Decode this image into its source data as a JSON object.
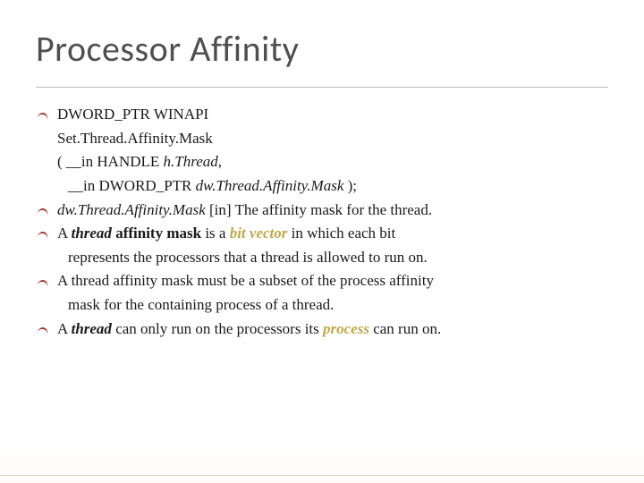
{
  "title": "Processor Affinity",
  "b1_l1": "DWORD_PTR WINAPI",
  "b1_l2": "Set.Thread.Affinity.Mask",
  "b1_l3_a": "( __in HANDLE ",
  "b1_l3_b": "h.Thread",
  "b1_l3_c": ",",
  "b1_l4_a": "__in DWORD_PTR ",
  "b1_l4_b": "dw.Thread.Affinity.Mask",
  "b1_l4_c": " );",
  "b2_a": "dw.Thread.Affinity.Mask",
  "b2_b": " [in] The affinity mask for the thread.",
  "b3_a": "A ",
  "b3_b": "thread",
  "b3_c": " ",
  "b3_d": "affinity mask",
  "b3_e": " is a ",
  "b3_f": "bit vector",
  "b3_g": " in which each bit",
  "b3_cont": "represents the processors that a thread is allowed to run on.",
  "b4": "A thread affinity mask must be a subset of the process affinity",
  "b4_cont": "mask for the containing process of a thread.",
  "b5_a": "A ",
  "b5_b": "thread",
  "b5_c": " can only run on the processors its ",
  "b5_d": "process",
  "b5_e": " can run on."
}
